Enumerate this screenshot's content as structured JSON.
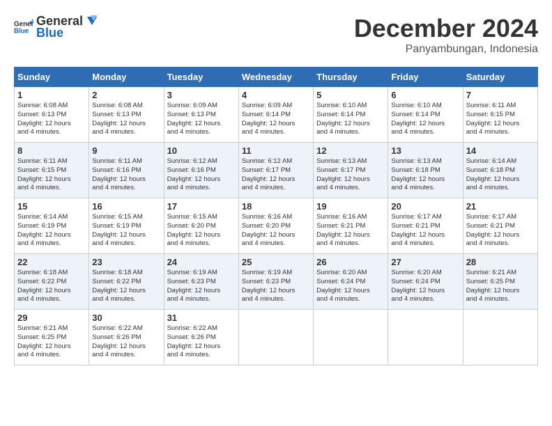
{
  "logo": {
    "text_general": "General",
    "text_blue": "Blue"
  },
  "title": {
    "month": "December 2024",
    "location": "Panyambungan, Indonesia"
  },
  "days_of_week": [
    "Sunday",
    "Monday",
    "Tuesday",
    "Wednesday",
    "Thursday",
    "Friday",
    "Saturday"
  ],
  "weeks": [
    [
      {
        "day": "1",
        "sunrise": "6:08 AM",
        "sunset": "6:13 PM",
        "daylight": "12 hours and 4 minutes."
      },
      {
        "day": "2",
        "sunrise": "6:08 AM",
        "sunset": "6:13 PM",
        "daylight": "12 hours and 4 minutes."
      },
      {
        "day": "3",
        "sunrise": "6:09 AM",
        "sunset": "6:13 PM",
        "daylight": "12 hours and 4 minutes."
      },
      {
        "day": "4",
        "sunrise": "6:09 AM",
        "sunset": "6:14 PM",
        "daylight": "12 hours and 4 minutes."
      },
      {
        "day": "5",
        "sunrise": "6:10 AM",
        "sunset": "6:14 PM",
        "daylight": "12 hours and 4 minutes."
      },
      {
        "day": "6",
        "sunrise": "6:10 AM",
        "sunset": "6:14 PM",
        "daylight": "12 hours and 4 minutes."
      },
      {
        "day": "7",
        "sunrise": "6:11 AM",
        "sunset": "6:15 PM",
        "daylight": "12 hours and 4 minutes."
      }
    ],
    [
      {
        "day": "8",
        "sunrise": "6:11 AM",
        "sunset": "6:15 PM",
        "daylight": "12 hours and 4 minutes."
      },
      {
        "day": "9",
        "sunrise": "6:11 AM",
        "sunset": "6:16 PM",
        "daylight": "12 hours and 4 minutes."
      },
      {
        "day": "10",
        "sunrise": "6:12 AM",
        "sunset": "6:16 PM",
        "daylight": "12 hours and 4 minutes."
      },
      {
        "day": "11",
        "sunrise": "6:12 AM",
        "sunset": "6:17 PM",
        "daylight": "12 hours and 4 minutes."
      },
      {
        "day": "12",
        "sunrise": "6:13 AM",
        "sunset": "6:17 PM",
        "daylight": "12 hours and 4 minutes."
      },
      {
        "day": "13",
        "sunrise": "6:13 AM",
        "sunset": "6:18 PM",
        "daylight": "12 hours and 4 minutes."
      },
      {
        "day": "14",
        "sunrise": "6:14 AM",
        "sunset": "6:18 PM",
        "daylight": "12 hours and 4 minutes."
      }
    ],
    [
      {
        "day": "15",
        "sunrise": "6:14 AM",
        "sunset": "6:19 PM",
        "daylight": "12 hours and 4 minutes."
      },
      {
        "day": "16",
        "sunrise": "6:15 AM",
        "sunset": "6:19 PM",
        "daylight": "12 hours and 4 minutes."
      },
      {
        "day": "17",
        "sunrise": "6:15 AM",
        "sunset": "6:20 PM",
        "daylight": "12 hours and 4 minutes."
      },
      {
        "day": "18",
        "sunrise": "6:16 AM",
        "sunset": "6:20 PM",
        "daylight": "12 hours and 4 minutes."
      },
      {
        "day": "19",
        "sunrise": "6:16 AM",
        "sunset": "6:21 PM",
        "daylight": "12 hours and 4 minutes."
      },
      {
        "day": "20",
        "sunrise": "6:17 AM",
        "sunset": "6:21 PM",
        "daylight": "12 hours and 4 minutes."
      },
      {
        "day": "21",
        "sunrise": "6:17 AM",
        "sunset": "6:21 PM",
        "daylight": "12 hours and 4 minutes."
      }
    ],
    [
      {
        "day": "22",
        "sunrise": "6:18 AM",
        "sunset": "6:22 PM",
        "daylight": "12 hours and 4 minutes."
      },
      {
        "day": "23",
        "sunrise": "6:18 AM",
        "sunset": "6:22 PM",
        "daylight": "12 hours and 4 minutes."
      },
      {
        "day": "24",
        "sunrise": "6:19 AM",
        "sunset": "6:23 PM",
        "daylight": "12 hours and 4 minutes."
      },
      {
        "day": "25",
        "sunrise": "6:19 AM",
        "sunset": "6:23 PM",
        "daylight": "12 hours and 4 minutes."
      },
      {
        "day": "26",
        "sunrise": "6:20 AM",
        "sunset": "6:24 PM",
        "daylight": "12 hours and 4 minutes."
      },
      {
        "day": "27",
        "sunrise": "6:20 AM",
        "sunset": "6:24 PM",
        "daylight": "12 hours and 4 minutes."
      },
      {
        "day": "28",
        "sunrise": "6:21 AM",
        "sunset": "6:25 PM",
        "daylight": "12 hours and 4 minutes."
      }
    ],
    [
      {
        "day": "29",
        "sunrise": "6:21 AM",
        "sunset": "6:25 PM",
        "daylight": "12 hours and 4 minutes."
      },
      {
        "day": "30",
        "sunrise": "6:22 AM",
        "sunset": "6:26 PM",
        "daylight": "12 hours and 4 minutes."
      },
      {
        "day": "31",
        "sunrise": "6:22 AM",
        "sunset": "6:26 PM",
        "daylight": "12 hours and 4 minutes."
      },
      null,
      null,
      null,
      null
    ]
  ],
  "labels": {
    "sunrise": "Sunrise:",
    "sunset": "Sunset:",
    "daylight": "Daylight:"
  }
}
